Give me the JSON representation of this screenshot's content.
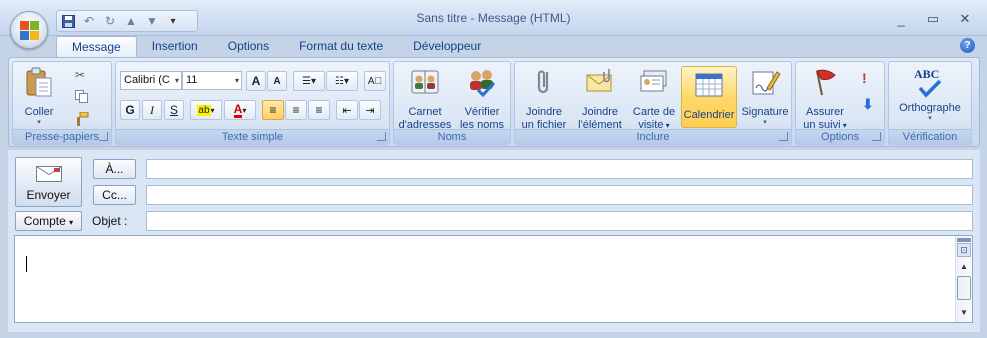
{
  "window": {
    "title": "Sans titre - Message (HTML)",
    "minimize": "_",
    "maximize": "▭",
    "close": "✕"
  },
  "qat": {
    "icons": [
      "save-icon",
      "undo-icon",
      "redo-icon",
      "previous-icon",
      "next-icon",
      "customize-icon"
    ]
  },
  "tabs": [
    {
      "label": "Message",
      "active": true
    },
    {
      "label": "Insertion",
      "active": false
    },
    {
      "label": "Options",
      "active": false
    },
    {
      "label": "Format du texte",
      "active": false
    },
    {
      "label": "Développeur",
      "active": false
    }
  ],
  "help": "?",
  "ribbon": {
    "clipboard": {
      "label": "Presse-papiers",
      "paste": "Coller",
      "paste_arrow": "▾"
    },
    "basic_text": {
      "label": "Texte simple",
      "font_name": "Calibri (C",
      "font_size": "11",
      "grow": "A",
      "shrink": "A",
      "bold": "G",
      "italic": "I",
      "underline": "S",
      "highlight": "ab",
      "font_color": "A"
    },
    "names": {
      "label": "Noms",
      "address_book_1": "Carnet",
      "address_book_2": "d'adresses",
      "check_names_1": "Vérifier",
      "check_names_2": "les noms"
    },
    "include": {
      "label": "Inclure",
      "attach_file_1": "Joindre",
      "attach_file_2": "un fichier",
      "attach_item_1": "Joindre",
      "attach_item_2": "l'élément",
      "business_card_1": "Carte de",
      "business_card_2": "visite",
      "calendar": "Calendrier",
      "signature": "Signature"
    },
    "options": {
      "label": "Options",
      "follow_up_1": "Assurer",
      "follow_up_2": "un suivi"
    },
    "proofing": {
      "label": "Vérification",
      "spelling": "Orthographe",
      "abc": "ABC"
    }
  },
  "form": {
    "send": "Envoyer",
    "to_button": "À...",
    "cc_button": "Cc...",
    "account_button": "Compte",
    "subject_label": "Objet :",
    "to_value": "",
    "cc_value": "",
    "subject_value": ""
  },
  "colors": {
    "accent": "#15428b",
    "hover": "#ffd86a",
    "ribbon_bg": "#d0def0"
  }
}
